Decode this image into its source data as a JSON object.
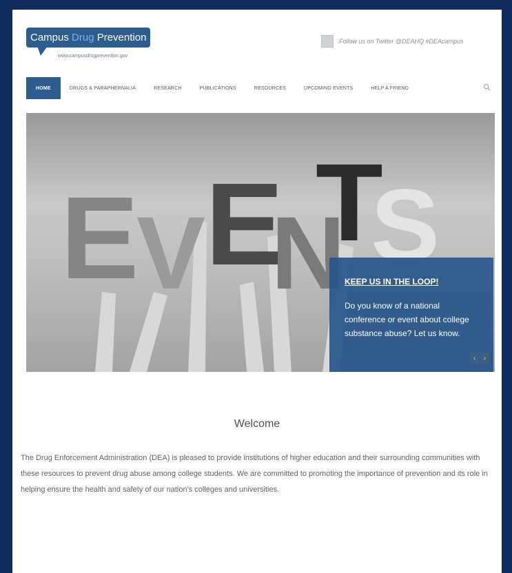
{
  "header": {
    "logo_title_part1": "Campus",
    "logo_title_part2": "Drug",
    "logo_title_part3": "Prevention",
    "logo_url": "www.campusdrugprevention.gov",
    "social_text": "Follow us on Twitter @DEAHQ #DEAcampus"
  },
  "nav": {
    "items": [
      "HOME",
      "DRUGS & PARAPHERNALIA",
      "RESEARCH",
      "PUBLICATIONS",
      "RESOURCES",
      "UPCOMING EVENTS",
      "HELP A FRIEND"
    ]
  },
  "hero": {
    "image_word": "EVENTS",
    "callout_title": "KEEP US IN THE LOOP!",
    "callout_text": "Do you know of a national conference or event about college substance abuse? Let us know."
  },
  "welcome": {
    "title": "Welcome",
    "body": "The Drug Enforcement Administration (DEA) is pleased to provide institutions of higher education and their surrounding communities with these resources to prevent drug abuse among college students. We are committed to promoting the importance of prevention and its role in helping ensure the health and safety of our nation's colleges and universities."
  },
  "icons": {
    "search": "search-icon",
    "social": "twitter-icon",
    "prev": "chevron-left-icon",
    "next": "chevron-right-icon"
  },
  "colors": {
    "frame": "#0f2a5c",
    "brand": "#2d5d8f",
    "callout": "#265589"
  }
}
